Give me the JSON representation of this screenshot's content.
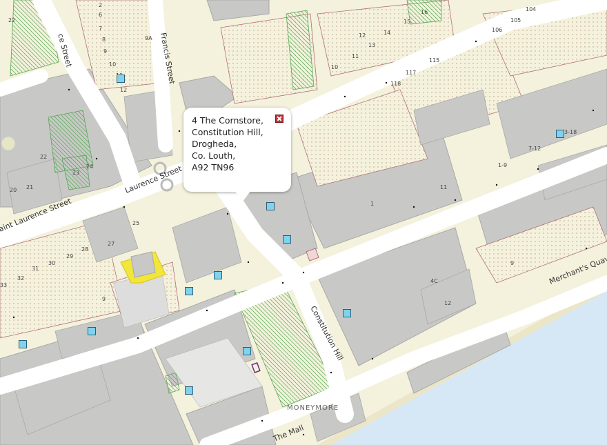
{
  "popup": {
    "lines": [
      "4 The Cornstore,",
      "Constitution Hill,",
      "Drogheda,",
      "Co. Louth,",
      "A92 TN96"
    ],
    "close_icon": "close-icon"
  },
  "streets": {
    "terrace_street": "ce Street",
    "francis_street": "Francis Street",
    "laurence_street": "Laurence Street",
    "saint_laurence_street": "aint Laurence Street",
    "constitution_hill": "Constitution Hill",
    "merchants_quay": "Merchant's Quav",
    "the_mall": "The Mall"
  },
  "place_label": "MONEYMORE",
  "house_numbers": [
    "2",
    "6",
    "7",
    "8",
    "9",
    "9A",
    "10",
    "11",
    "12",
    "22",
    "22",
    "23",
    "24",
    "20",
    "21",
    "25",
    "27",
    "28",
    "29",
    "30",
    "31",
    "32",
    "33",
    "9",
    "10",
    "11",
    "12",
    "13",
    "14",
    "15",
    "16",
    "104",
    "105",
    "106",
    "115",
    "117",
    "118",
    "3-18",
    "7-12",
    "1-9",
    "11",
    "1",
    "4C",
    "12",
    "9"
  ],
  "colors": {
    "road": "#ffffff",
    "building": "#c8c8c6",
    "block": "#b8b8b6",
    "land": "#f4f1dc",
    "green": "#8fc989",
    "water": "#d6e8f6",
    "highlight": "#f2e53b",
    "marker": "#7fd3ec"
  }
}
